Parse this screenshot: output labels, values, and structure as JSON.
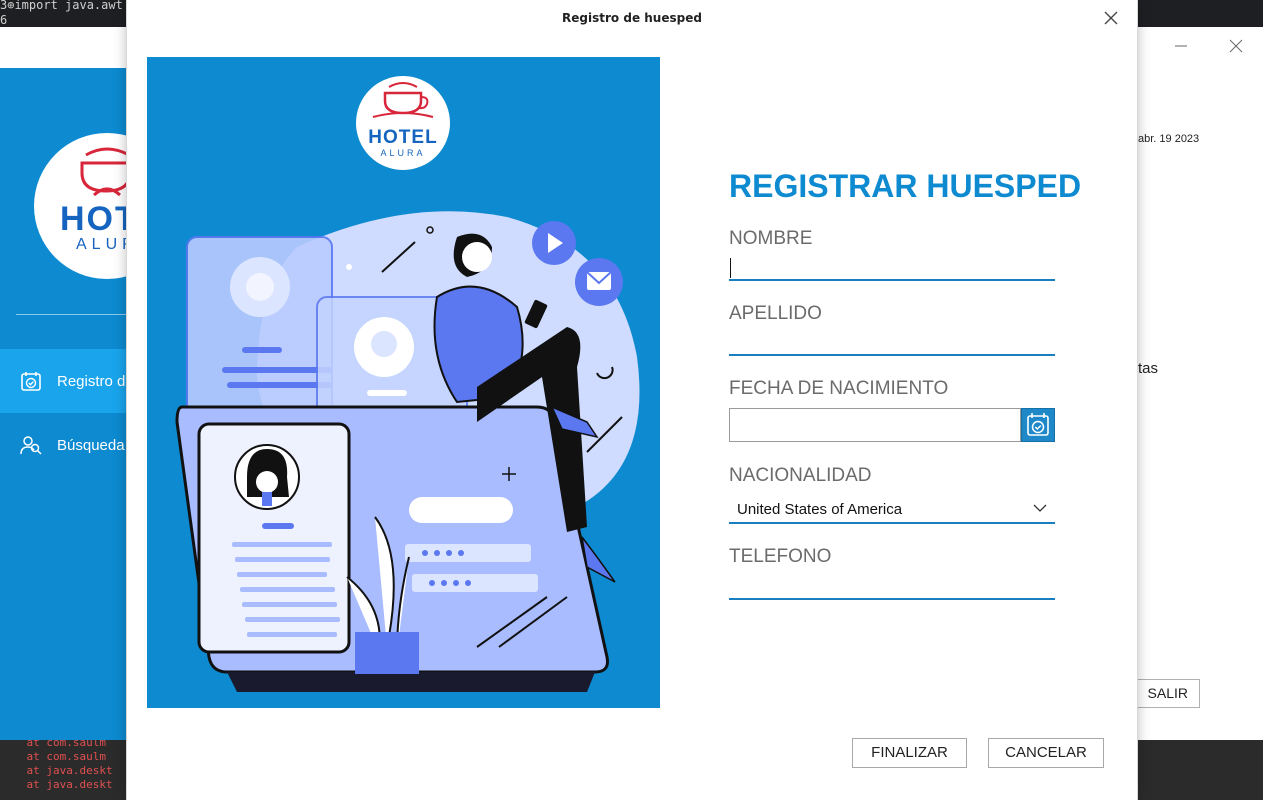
{
  "ide": {
    "code_lines": [
      "3⊕import java.awt",
      "6"
    ],
    "console_lines": [
      "    at com.saulm",
      "    at com.saulm",
      "    at java.deskt",
      "    at java.deskt"
    ]
  },
  "background_window": {
    "logo": {
      "line1": "HOTEL",
      "line2": "ALURA"
    },
    "nav": [
      {
        "label": "Registro d",
        "icon": "calendar-check-icon",
        "active": true
      },
      {
        "label": "Búsqueda",
        "icon": "people-search-icon",
        "active": false
      }
    ],
    "date_text": "abr. 19 2023",
    "partial_text": "tas",
    "salir_label": "SALIR"
  },
  "dialog": {
    "title": "Registro de huesped",
    "logo": {
      "line1": "HOTEL",
      "line2": "ALURA"
    },
    "form": {
      "heading": "REGISTRAR HUESPED",
      "fields": {
        "nombre": {
          "label": "NOMBRE",
          "value": ""
        },
        "apellido": {
          "label": "APELLIDO",
          "value": ""
        },
        "fecha_nacimiento": {
          "label": "FECHA DE NACIMIENTO",
          "value": ""
        },
        "nacionalidad": {
          "label": "NACIONALIDAD",
          "value": "United States of America"
        },
        "telefono": {
          "label": "TELEFONO",
          "value": ""
        }
      }
    },
    "buttons": {
      "finalizar": "FINALIZAR",
      "cancelar": "CANCELAR"
    }
  },
  "colors": {
    "brand_blue": "#0d8ad0",
    "heading_blue": "#0d8ad0",
    "label_gray": "#6b6b6b",
    "underline_blue": "#1a7fc0",
    "illustration_periwinkle": "#5b78f0",
    "logo_red": "#d8263a"
  }
}
